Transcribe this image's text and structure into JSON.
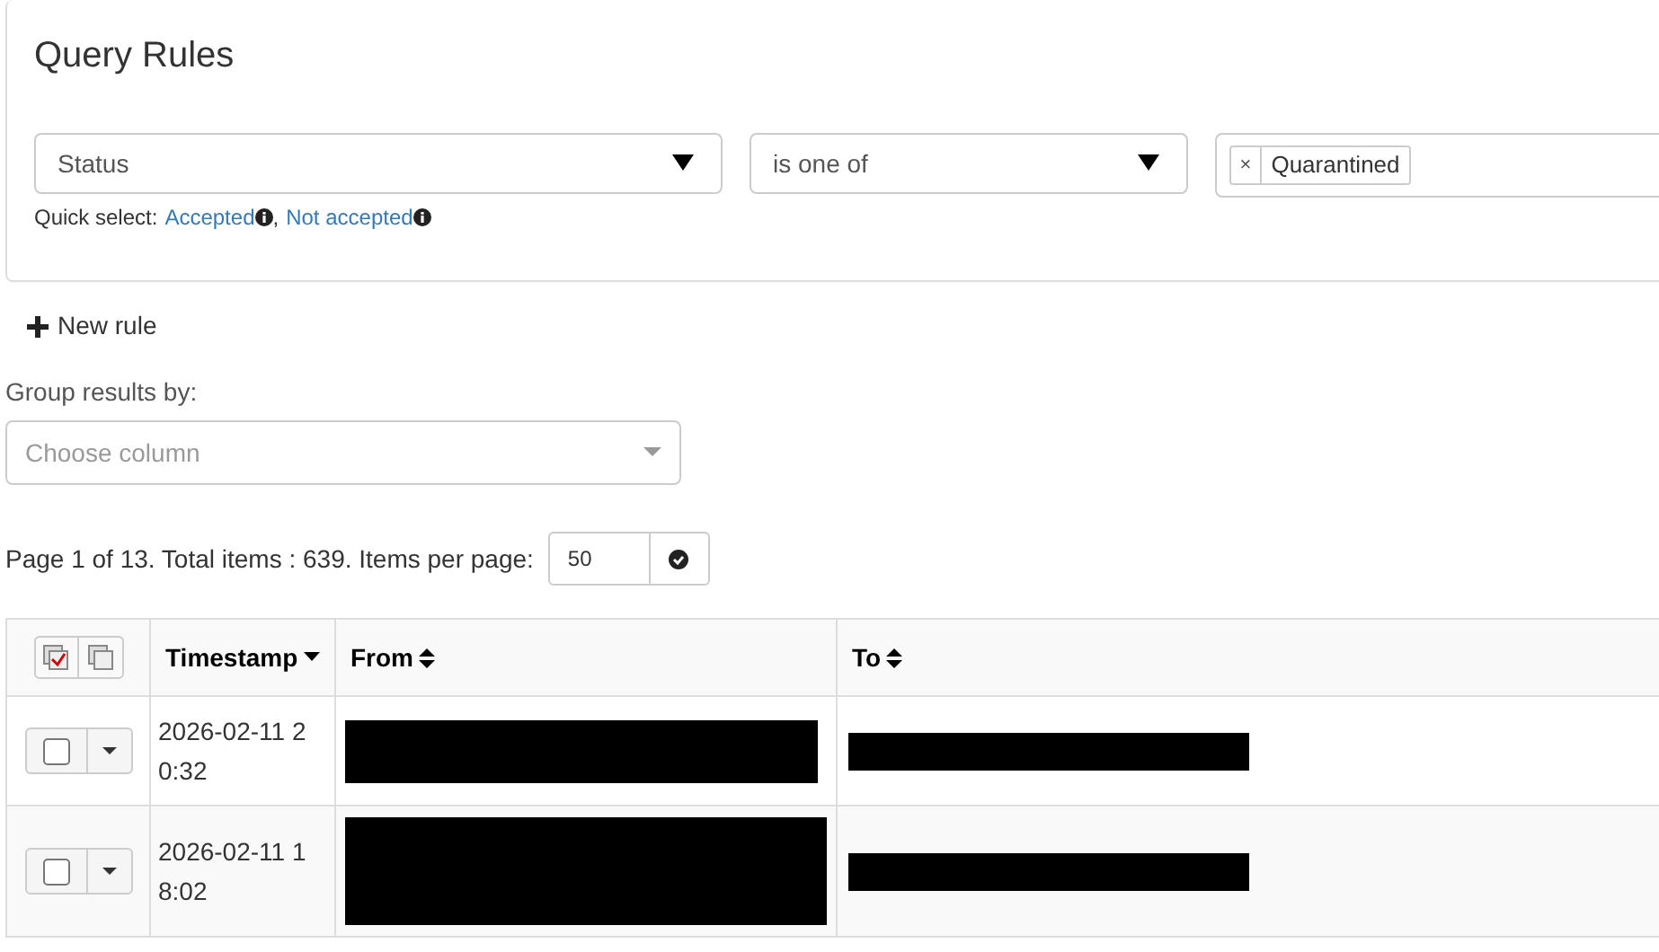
{
  "panel": {
    "title": "Query Rules",
    "rule": {
      "field": "Status",
      "operator": "is one of",
      "values": [
        {
          "remove": "×",
          "label": "Quarantined"
        }
      ],
      "quick_select_label": "Quick select:",
      "quick_links": [
        "Accepted",
        "Not accepted"
      ],
      "link_separator": ","
    }
  },
  "new_rule": "New rule",
  "group_by": {
    "label": "Group results by:",
    "placeholder": "Choose column"
  },
  "pager": {
    "text": "Page 1 of 13. Total items : 639. Items per page:",
    "per_page": "50"
  },
  "table": {
    "columns": [
      {
        "kind": "select"
      },
      {
        "kind": "sorted-desc",
        "label": "Timestamp"
      },
      {
        "kind": "sortable",
        "label": "From"
      },
      {
        "kind": "sortable",
        "label": "To"
      }
    ],
    "rows": [
      {
        "checked": false,
        "timestamp": "2026-02-11 20:32",
        "from": {
          "kind": "redacted"
        },
        "to": {
          "kind": "redacted"
        }
      },
      {
        "checked": false,
        "timestamp": "2026-02-11 18:02",
        "from": {
          "kind": "redacted-tall"
        },
        "to": {
          "kind": "redacted"
        }
      }
    ]
  }
}
